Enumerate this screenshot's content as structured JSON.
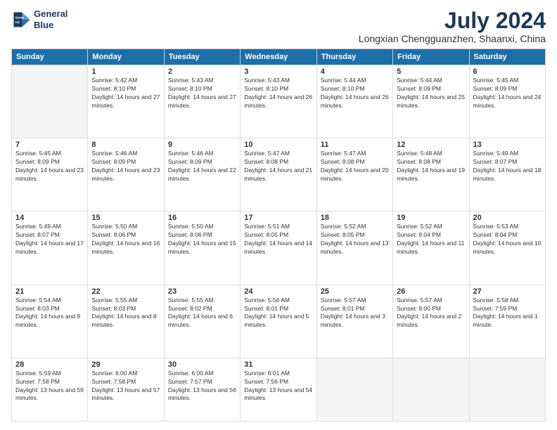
{
  "logo": {
    "line1": "General",
    "line2": "Blue"
  },
  "title": "July 2024",
  "location": "Longxian Chengguanzhen, Shaanxi, China",
  "days_of_week": [
    "Sunday",
    "Monday",
    "Tuesday",
    "Wednesday",
    "Thursday",
    "Friday",
    "Saturday"
  ],
  "weeks": [
    [
      {
        "day": "",
        "empty": true
      },
      {
        "day": "1",
        "sunrise": "5:42 AM",
        "sunset": "8:10 PM",
        "daylight": "14 hours and 27 minutes."
      },
      {
        "day": "2",
        "sunrise": "5:43 AM",
        "sunset": "8:10 PM",
        "daylight": "14 hours and 27 minutes."
      },
      {
        "day": "3",
        "sunrise": "5:43 AM",
        "sunset": "8:10 PM",
        "daylight": "14 hours and 26 minutes."
      },
      {
        "day": "4",
        "sunrise": "5:44 AM",
        "sunset": "8:10 PM",
        "daylight": "14 hours and 26 minutes."
      },
      {
        "day": "5",
        "sunrise": "5:44 AM",
        "sunset": "8:09 PM",
        "daylight": "14 hours and 25 minutes."
      },
      {
        "day": "6",
        "sunrise": "5:45 AM",
        "sunset": "8:09 PM",
        "daylight": "14 hours and 24 minutes."
      }
    ],
    [
      {
        "day": "7",
        "sunrise": "5:45 AM",
        "sunset": "8:09 PM",
        "daylight": "14 hours and 23 minutes."
      },
      {
        "day": "8",
        "sunrise": "5:46 AM",
        "sunset": "8:09 PM",
        "daylight": "14 hours and 23 minutes."
      },
      {
        "day": "9",
        "sunrise": "5:46 AM",
        "sunset": "8:09 PM",
        "daylight": "14 hours and 22 minutes."
      },
      {
        "day": "10",
        "sunrise": "5:47 AM",
        "sunset": "8:08 PM",
        "daylight": "14 hours and 21 minutes."
      },
      {
        "day": "11",
        "sunrise": "5:47 AM",
        "sunset": "8:08 PM",
        "daylight": "14 hours and 20 minutes."
      },
      {
        "day": "12",
        "sunrise": "5:48 AM",
        "sunset": "8:08 PM",
        "daylight": "14 hours and 19 minutes."
      },
      {
        "day": "13",
        "sunrise": "5:49 AM",
        "sunset": "8:07 PM",
        "daylight": "14 hours and 18 minutes."
      }
    ],
    [
      {
        "day": "14",
        "sunrise": "5:49 AM",
        "sunset": "8:07 PM",
        "daylight": "14 hours and 17 minutes."
      },
      {
        "day": "15",
        "sunrise": "5:50 AM",
        "sunset": "8:06 PM",
        "daylight": "14 hours and 16 minutes."
      },
      {
        "day": "16",
        "sunrise": "5:50 AM",
        "sunset": "8:06 PM",
        "daylight": "14 hours and 15 minutes."
      },
      {
        "day": "17",
        "sunrise": "5:51 AM",
        "sunset": "8:05 PM",
        "daylight": "14 hours and 14 minutes."
      },
      {
        "day": "18",
        "sunrise": "5:52 AM",
        "sunset": "8:05 PM",
        "daylight": "14 hours and 13 minutes."
      },
      {
        "day": "19",
        "sunrise": "5:52 AM",
        "sunset": "8:04 PM",
        "daylight": "14 hours and 11 minutes."
      },
      {
        "day": "20",
        "sunrise": "5:53 AM",
        "sunset": "8:04 PM",
        "daylight": "14 hours and 10 minutes."
      }
    ],
    [
      {
        "day": "21",
        "sunrise": "5:54 AM",
        "sunset": "8:03 PM",
        "daylight": "14 hours and 9 minutes."
      },
      {
        "day": "22",
        "sunrise": "5:55 AM",
        "sunset": "8:03 PM",
        "daylight": "14 hours and 8 minutes."
      },
      {
        "day": "23",
        "sunrise": "5:55 AM",
        "sunset": "8:02 PM",
        "daylight": "14 hours and 6 minutes."
      },
      {
        "day": "24",
        "sunrise": "5:56 AM",
        "sunset": "8:01 PM",
        "daylight": "14 hours and 5 minutes."
      },
      {
        "day": "25",
        "sunrise": "5:57 AM",
        "sunset": "8:01 PM",
        "daylight": "14 hours and 3 minutes."
      },
      {
        "day": "26",
        "sunrise": "5:57 AM",
        "sunset": "8:00 PM",
        "daylight": "14 hours and 2 minutes."
      },
      {
        "day": "27",
        "sunrise": "5:58 AM",
        "sunset": "7:59 PM",
        "daylight": "14 hours and 1 minute."
      }
    ],
    [
      {
        "day": "28",
        "sunrise": "5:59 AM",
        "sunset": "7:58 PM",
        "daylight": "13 hours and 59 minutes."
      },
      {
        "day": "29",
        "sunrise": "6:00 AM",
        "sunset": "7:58 PM",
        "daylight": "13 hours and 57 minutes."
      },
      {
        "day": "30",
        "sunrise": "6:00 AM",
        "sunset": "7:57 PM",
        "daylight": "13 hours and 56 minutes."
      },
      {
        "day": "31",
        "sunrise": "6:01 AM",
        "sunset": "7:56 PM",
        "daylight": "13 hours and 54 minutes."
      },
      {
        "day": "",
        "empty": true
      },
      {
        "day": "",
        "empty": true
      },
      {
        "day": "",
        "empty": true
      }
    ]
  ]
}
